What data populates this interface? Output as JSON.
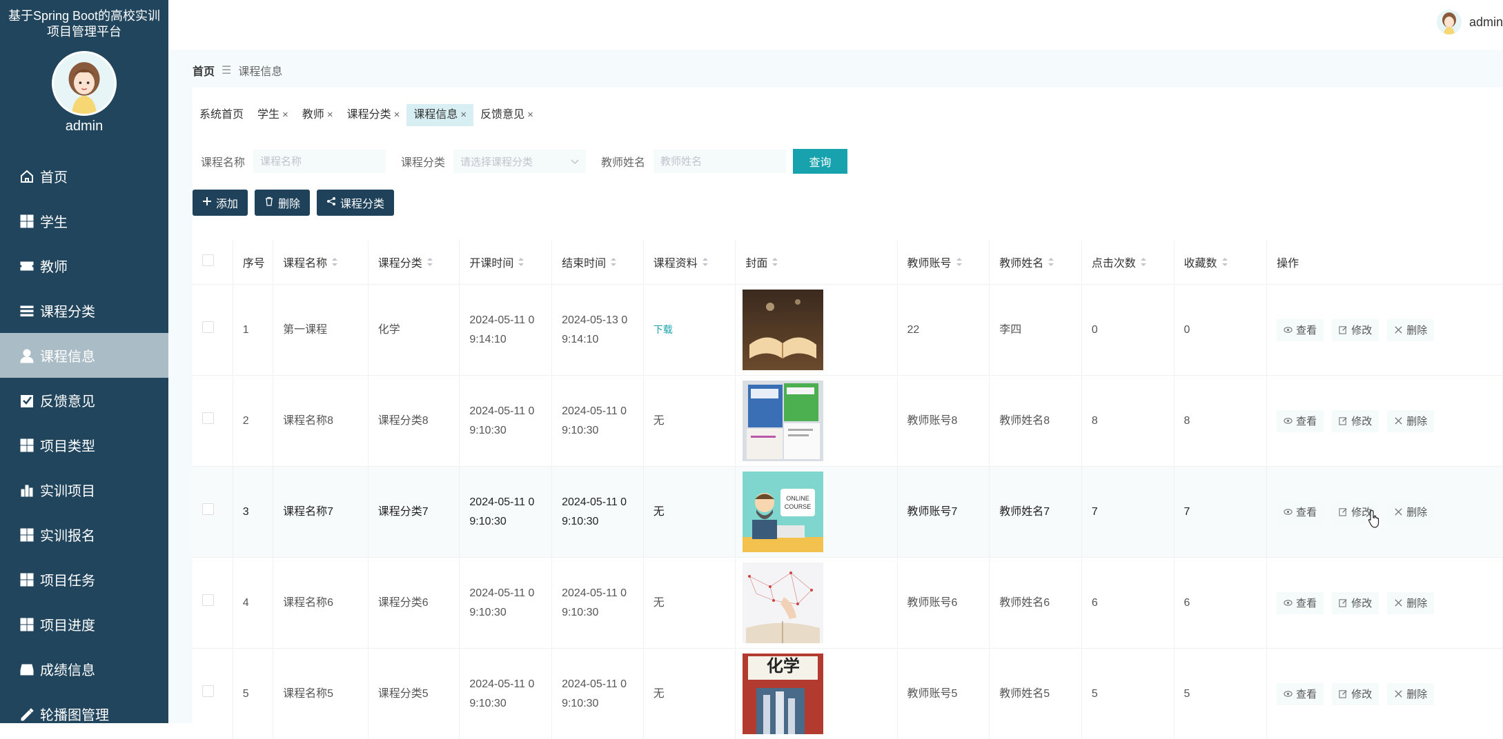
{
  "app": {
    "title_line1": "基于Spring Boot的高校实训",
    "title_line2": "项目管理平台"
  },
  "sidebar": {
    "user": "admin",
    "items": [
      {
        "label": "首页",
        "icon": "home-icon"
      },
      {
        "label": "学生",
        "icon": "grid-icon"
      },
      {
        "label": "教师",
        "icon": "ticket-icon"
      },
      {
        "label": "课程分类",
        "icon": "list-icon"
      },
      {
        "label": "课程信息",
        "icon": "user-icon"
      },
      {
        "label": "反馈意见",
        "icon": "check-square-icon"
      },
      {
        "label": "项目类型",
        "icon": "grid-icon"
      },
      {
        "label": "实训项目",
        "icon": "bar-chart-icon"
      },
      {
        "label": "实训报名",
        "icon": "grid-icon"
      },
      {
        "label": "项目任务",
        "icon": "grid-icon"
      },
      {
        "label": "项目进度",
        "icon": "grid-icon"
      },
      {
        "label": "成绩信息",
        "icon": "inbox-icon"
      },
      {
        "label": "轮播图管理",
        "icon": "edit-icon"
      }
    ]
  },
  "header": {
    "user": "admin"
  },
  "breadcrumb": {
    "home": "首页",
    "current": "课程信息"
  },
  "tabs": [
    {
      "label": "系统首页",
      "closable": false
    },
    {
      "label": "学生",
      "closable": true
    },
    {
      "label": "教师",
      "closable": true
    },
    {
      "label": "课程分类",
      "closable": true
    },
    {
      "label": "课程信息",
      "closable": true
    },
    {
      "label": "反馈意见",
      "closable": true
    }
  ],
  "search": {
    "course_label": "课程名称",
    "course_placeholder": "课程名称",
    "category_label": "课程分类",
    "category_placeholder": "请选择课程分类",
    "teacher_label": "教师姓名",
    "teacher_placeholder": "教师姓名",
    "query_button": "查询"
  },
  "actions": {
    "add": "添加",
    "delete": "删除",
    "category": "课程分类"
  },
  "table": {
    "headers": [
      "序号",
      "课程名称",
      "课程分类",
      "开课时间",
      "结束时间",
      "课程资料",
      "封面",
      "教师账号",
      "教师姓名",
      "点击次数",
      "收藏数",
      "操作"
    ],
    "ops": {
      "view": "查看",
      "edit": "修改",
      "delete": "删除"
    },
    "rows": [
      {
        "no": "1",
        "name": "第一课程",
        "category": "化学",
        "start1": "2024-05-11 0",
        "start2": "9:14:10",
        "end1": "2024-05-13 0",
        "end2": "9:14:10",
        "material": "下载",
        "material_link": true,
        "cover": "book",
        "account": "22",
        "teacher": "李四",
        "clicks": "0",
        "favs": "0"
      },
      {
        "no": "2",
        "name": "课程名称8",
        "category": "课程分类8",
        "start1": "2024-05-11 0",
        "start2": "9:10:30",
        "end1": "2024-05-11 0",
        "end2": "9:10:30",
        "material": "无",
        "material_link": false,
        "cover": "books",
        "account": "教师账号8",
        "teacher": "教师姓名8",
        "clicks": "8",
        "favs": "8"
      },
      {
        "no": "3",
        "name": "课程名称7",
        "category": "课程分类7",
        "start1": "2024-05-11 0",
        "start2": "9:10:30",
        "end1": "2024-05-11 0",
        "end2": "9:10:30",
        "material": "无",
        "material_link": false,
        "cover": "online",
        "account": "教师账号7",
        "teacher": "教师姓名7",
        "clicks": "7",
        "favs": "7"
      },
      {
        "no": "4",
        "name": "课程名称6",
        "category": "课程分类6",
        "start1": "2024-05-11 0",
        "start2": "9:10:30",
        "end1": "2024-05-11 0",
        "end2": "9:10:30",
        "material": "无",
        "material_link": false,
        "cover": "network",
        "account": "教师账号6",
        "teacher": "教师姓名6",
        "clicks": "6",
        "favs": "6"
      },
      {
        "no": "5",
        "name": "课程名称5",
        "category": "课程分类5",
        "start1": "2024-05-11 0",
        "start2": "9:10:30",
        "end1": "2024-05-11 0",
        "end2": "9:10:30",
        "material": "无",
        "material_link": false,
        "cover": "chemistry",
        "cover_text": "化学",
        "account": "教师账号5",
        "teacher": "教师姓名5",
        "clicks": "5",
        "favs": "5"
      }
    ]
  },
  "colors": {
    "sidebar": "#21455d",
    "active_menu": "#aabcc6",
    "accent": "#18a2ad",
    "action_button": "#1f425a"
  }
}
